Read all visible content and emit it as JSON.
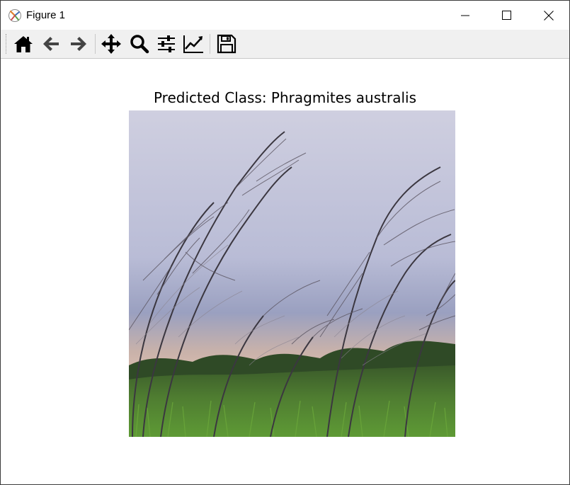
{
  "window": {
    "title": "Figure 1"
  },
  "toolbar": {
    "buttons": [
      {
        "name": "home",
        "icon": "home-icon"
      },
      {
        "name": "back",
        "icon": "arrow-left-icon"
      },
      {
        "name": "forward",
        "icon": "arrow-right-icon"
      },
      {
        "name": "pan",
        "icon": "move-icon"
      },
      {
        "name": "zoom",
        "icon": "magnifier-icon"
      },
      {
        "name": "configure-subplots",
        "icon": "sliders-icon"
      },
      {
        "name": "edit-axis",
        "icon": "line-chart-icon"
      },
      {
        "name": "save",
        "icon": "floppy-disk-icon"
      }
    ]
  },
  "figure": {
    "title": "Predicted Class: Phragmites australis",
    "image_subject": "Phragmites australis reed plumes against an overcast sky"
  },
  "colors": {
    "toolbar_bg": "#f0f0f0",
    "icon": "#000000",
    "sky": "#c9c9dc",
    "grass": "#4d8a2d"
  }
}
